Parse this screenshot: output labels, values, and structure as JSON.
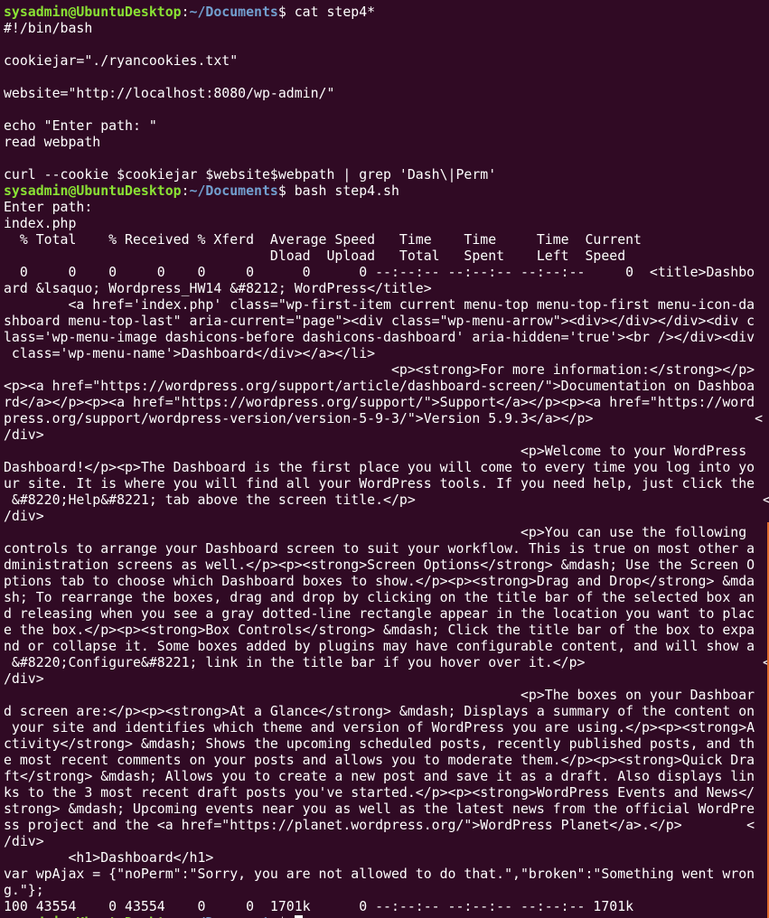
{
  "prompt": {
    "user_host": "sysadmin@UbuntuDesktop",
    "separator": ":",
    "path": "~/Documents",
    "suffix": "$ "
  },
  "commands": [
    "cat step4*",
    "bash step4.sh"
  ],
  "cat_output": [
    "#!/bin/bash",
    "",
    "cookiejar=\"./ryancookies.txt\"",
    "",
    "website=\"http://localhost:8080/wp-admin/\"",
    "",
    "echo \"Enter path: \"",
    "read webpath",
    "",
    "curl --cookie $cookiejar $website$webpath | grep 'Dash\\|Perm'"
  ],
  "run_output": [
    "Enter path:",
    "index.php",
    "  % Total    % Received % Xferd  Average Speed   Time    Time     Time  Current",
    "                                 Dload  Upload   Total   Spent    Left  Speed",
    "  0     0    0     0    0     0      0      0 --:--:-- --:--:-- --:--:--     0  <title>Dashbo",
    "ard &lsaquo; Wordpress_HW14 &#8212; WordPress</title>",
    "        <a href='index.php' class=\"wp-first-item current menu-top menu-top-first menu-icon-da",
    "shboard menu-top-last\" aria-current=\"page\"><div class=\"wp-menu-arrow\"><div></div></div><div c",
    "lass='wp-menu-image dashicons-before dashicons-dashboard' aria-hidden='true'><br /></div><div",
    " class='wp-menu-name'>Dashboard</div></a></li>",
    "                                                <p><strong>For more information:</strong></p>",
    "<p><a href=\"https://wordpress.org/support/article/dashboard-screen/\">Documentation on Dashboa",
    "rd</a></p><p><a href=\"https://wordpress.org/support/\">Support</a></p><p><a href=\"https://word",
    "press.org/support/wordpress-version/version-5-9-3/\">Version 5.9.3</a></p>                    <",
    "/div>",
    "                                                                <p>Welcome to your WordPress",
    "Dashboard!</p><p>The Dashboard is the first place you will come to every time you log into yo",
    "ur site. It is where you will find all your WordPress tools. If you need help, just click the",
    " &#8220;Help&#8221; tab above the screen title.</p>                                           <",
    "/div>",
    "                                                                <p>You can use the following",
    "controls to arrange your Dashboard screen to suit your workflow. This is true on most other a",
    "dministration screens as well.</p><p><strong>Screen Options</strong> &mdash; Use the Screen O",
    "ptions tab to choose which Dashboard boxes to show.</p><p><strong>Drag and Drop</strong> &mda",
    "sh; To rearrange the boxes, drag and drop by clicking on the title bar of the selected box an",
    "d releasing when you see a gray dotted-line rectangle appear in the location you want to plac",
    "e the box.</p><p><strong>Box Controls</strong> &mdash; Click the title bar of the box to expa",
    "nd or collapse it. Some boxes added by plugins may have configurable content, and will show a",
    " &#8220;Configure&#8221; link in the title bar if you hover over it.</p>                      <",
    "/div>",
    "                                                                <p>The boxes on your Dashboar",
    "d screen are:</p><p><strong>At a Glance</strong> &mdash; Displays a summary of the content on",
    " your site and identifies which theme and version of WordPress you are using.</p><p><strong>A",
    "ctivity</strong> &mdash; Shows the upcoming scheduled posts, recently published posts, and th",
    "e most recent comments on your posts and allows you to moderate them.</p><p><strong>Quick Dra",
    "ft</strong> &mdash; Allows you to create a new post and save it as a draft. Also displays lin",
    "ks to the 3 most recent draft posts you've started.</p><p><strong>WordPress Events and News</",
    "strong> &mdash; Upcoming events near you as well as the latest news from the official WordPre",
    "ss project and the <a href=\"https://planet.wordpress.org/\">WordPress Planet</a>.</p>        <",
    "/div>",
    "        <h1>Dashboard</h1>",
    "var wpAjax = {\"noPerm\":\"Sorry, you are not allowed to do that.\",\"broken\":\"Something went wron",
    "g.\"};",
    "100 43554    0 43554    0     0  1701k      0 --:--:-- --:--:-- --:--:-- 1701k"
  ],
  "colors": {
    "background": "#300a24",
    "text": "#ffffff",
    "prompt_user": "#8ae234",
    "prompt_path": "#729fcf"
  }
}
